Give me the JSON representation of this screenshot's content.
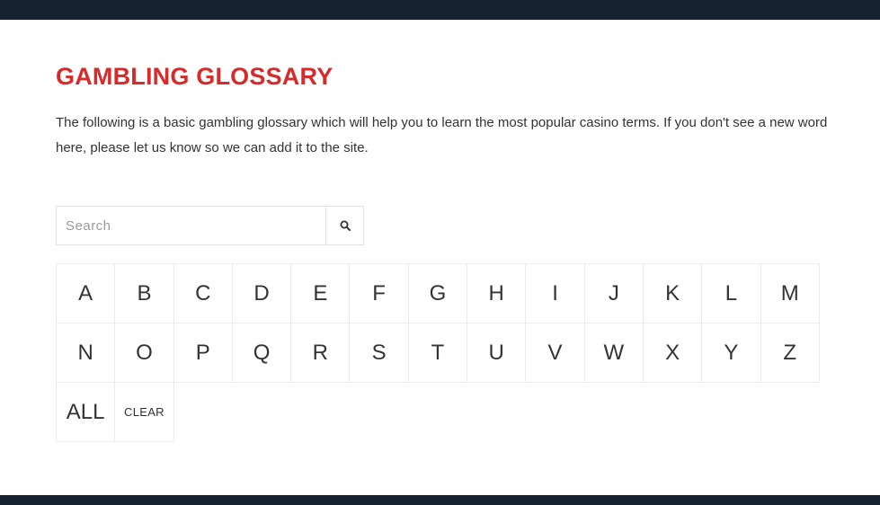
{
  "header": {},
  "page": {
    "title": "GAMBLING GLOSSARY",
    "intro": "The following is a basic gambling glossary which will help you to learn the most popular casino terms. If you don't see a new word here, please let us know so we can add it to the site."
  },
  "search": {
    "placeholder": "Search",
    "value": "",
    "icon": "search-icon"
  },
  "letters": {
    "row1": [
      "A",
      "B",
      "C",
      "D",
      "E",
      "F",
      "G",
      "H",
      "I",
      "J",
      "K",
      "L",
      "M"
    ],
    "row2": [
      "N",
      "O",
      "P",
      "Q",
      "R",
      "S",
      "T",
      "U",
      "V",
      "W",
      "X",
      "Y",
      "Z"
    ],
    "all_label": "ALL",
    "clear_label": "CLEAR"
  },
  "colors": {
    "title": "#d72b2b",
    "bars": "#162230",
    "text": "#333333"
  }
}
